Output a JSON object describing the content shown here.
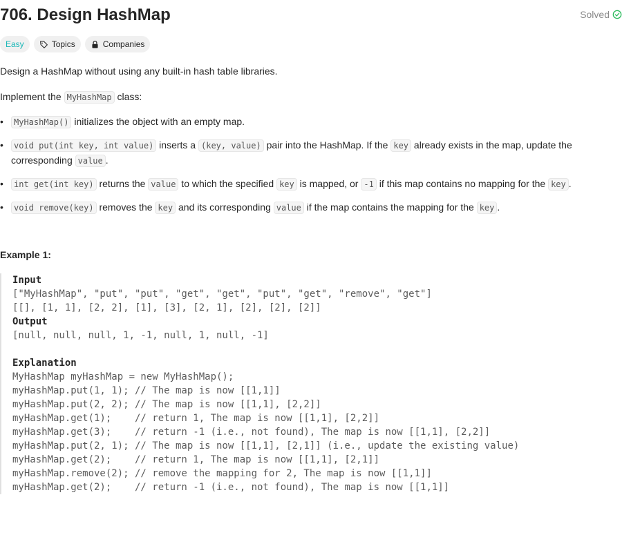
{
  "header": {
    "title": "706. Design HashMap",
    "status": "Solved"
  },
  "tags": {
    "difficulty": "Easy",
    "topics": "Topics",
    "companies": "Companies"
  },
  "description": {
    "intro": "Design a HashMap without using any built-in hash table libraries.",
    "impl_prefix": "Implement the ",
    "impl_class": "MyHashMap",
    "impl_suffix": " class:",
    "items": [
      {
        "code": "MyHashMap()",
        "text": " initializes the object with an empty map."
      },
      {
        "code": "void put(int key, int value)",
        "t1": " inserts a ",
        "c2": "(key, value)",
        "t2": " pair into the HashMap. If the ",
        "c3": "key",
        "t3": " already exists in the map, update the corresponding ",
        "c4": "value",
        "t4": "."
      },
      {
        "code": "int get(int key)",
        "t1": " returns the ",
        "c2": "value",
        "t2": " to which the specified ",
        "c3": "key",
        "t3": " is mapped, or ",
        "c4": "-1",
        "t4": " if this map contains no mapping for the ",
        "c5": "key",
        "t5": "."
      },
      {
        "code": "void remove(key)",
        "t1": " removes the ",
        "c2": "key",
        "t2": " and its corresponding ",
        "c3": "value",
        "t3": " if the map contains the mapping for the ",
        "c4": "key",
        "t4": "."
      }
    ]
  },
  "example": {
    "title": "Example 1:",
    "input_label": "Input",
    "input_line1": "[\"MyHashMap\", \"put\", \"put\", \"get\", \"get\", \"put\", \"get\", \"remove\", \"get\"]",
    "input_line2": "[[], [1, 1], [2, 2], [1], [3], [2, 1], [2], [2], [2]]",
    "output_label": "Output",
    "output_line": "[null, null, null, 1, -1, null, 1, null, -1]",
    "explanation_label": "Explanation",
    "explanation_lines": [
      "MyHashMap myHashMap = new MyHashMap();",
      "myHashMap.put(1, 1); // The map is now [[1,1]]",
      "myHashMap.put(2, 2); // The map is now [[1,1], [2,2]]",
      "myHashMap.get(1);    // return 1, The map is now [[1,1], [2,2]]",
      "myHashMap.get(3);    // return -1 (i.e., not found), The map is now [[1,1], [2,2]]",
      "myHashMap.put(2, 1); // The map is now [[1,1], [2,1]] (i.e., update the existing value)",
      "myHashMap.get(2);    // return 1, The map is now [[1,1], [2,1]]",
      "myHashMap.remove(2); // remove the mapping for 2, The map is now [[1,1]]",
      "myHashMap.get(2);    // return -1 (i.e., not found), The map is now [[1,1]]"
    ]
  },
  "colors": {
    "easy": "#1cb8b8",
    "solved_check": "#2cbb5d"
  }
}
